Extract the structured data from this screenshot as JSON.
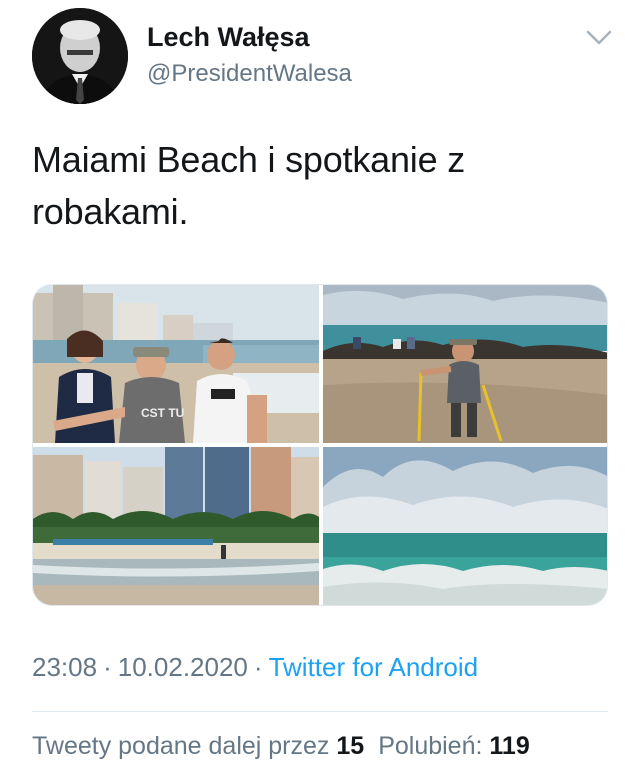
{
  "author": {
    "display_name": "Lech Wałęsa",
    "handle": "@PresidentWalesa",
    "avatar_icon": "portrait-avatar"
  },
  "menu": {
    "icon": "chevron-down-icon"
  },
  "tweet": {
    "text_line1": "Maiami Beach i spotkanie z",
    "text_line2": "robakami."
  },
  "media": {
    "photos": [
      {
        "label": "group-photo-beach"
      },
      {
        "label": "man-with-walking-poles-on-beach"
      },
      {
        "label": "hotels-and-palm-trees-beach"
      },
      {
        "label": "ocean-waves-and-clouds"
      }
    ],
    "shirt_text": "CST TU"
  },
  "meta": {
    "time": "23:08",
    "date": "10.02.2020",
    "separator": "·",
    "source": "Twitter for Android"
  },
  "stats": {
    "retweets_label": "Tweety podane dalej przez",
    "retweets_count": "15",
    "likes_label": "Polubień:",
    "likes_count": "119"
  },
  "colors": {
    "text": "#14171a",
    "secondary": "#657786",
    "link": "#1da1f2",
    "divider": "#e1e8ed"
  }
}
